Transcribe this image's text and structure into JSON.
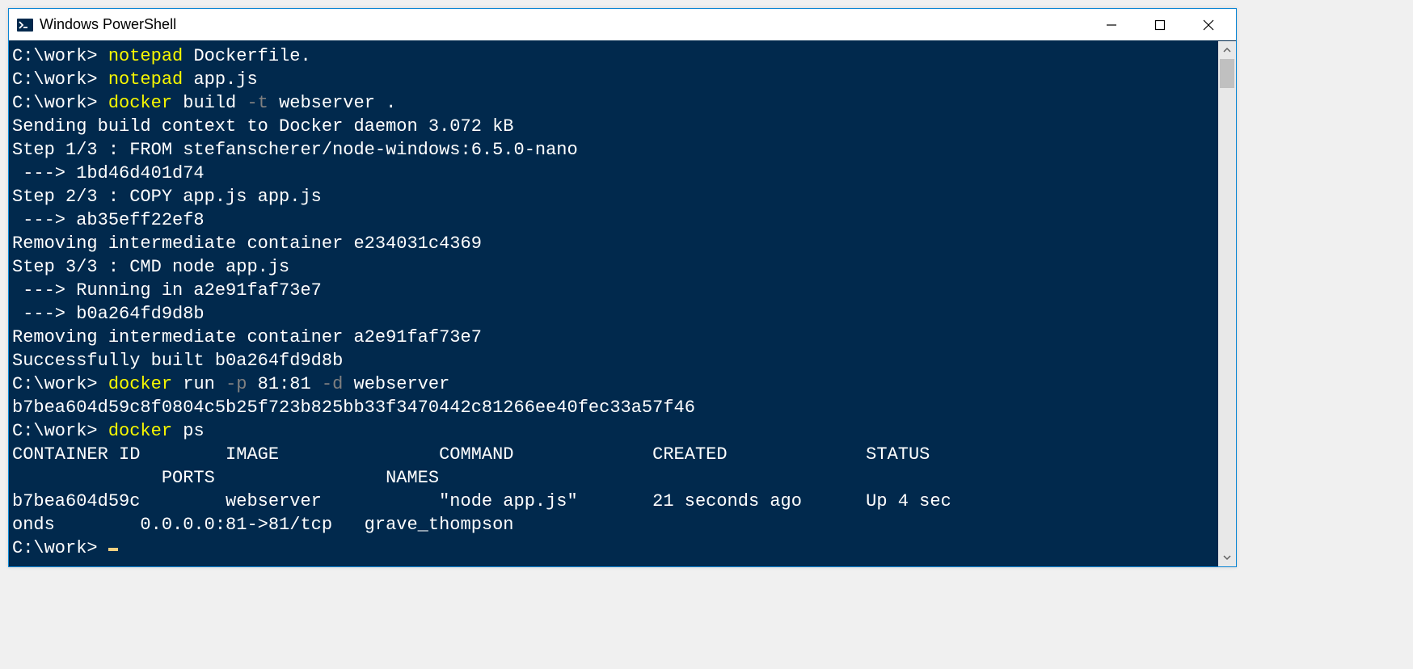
{
  "window": {
    "title": "Windows PowerShell"
  },
  "terminal": {
    "lines": [
      {
        "segments": [
          {
            "text": "C:\\work> ",
            "class": ""
          },
          {
            "text": "notepad ",
            "class": "c-yellow"
          },
          {
            "text": "Dockerfile.",
            "class": ""
          }
        ]
      },
      {
        "segments": [
          {
            "text": "C:\\work> ",
            "class": ""
          },
          {
            "text": "notepad ",
            "class": "c-yellow"
          },
          {
            "text": "app.js",
            "class": ""
          }
        ]
      },
      {
        "segments": [
          {
            "text": "C:\\work> ",
            "class": ""
          },
          {
            "text": "docker ",
            "class": "c-yellow"
          },
          {
            "text": "build ",
            "class": ""
          },
          {
            "text": "-t",
            "class": "c-gray"
          },
          {
            "text": " webserver .",
            "class": ""
          }
        ]
      },
      {
        "segments": [
          {
            "text": "Sending build context to Docker daemon 3.072 kB",
            "class": ""
          }
        ]
      },
      {
        "segments": [
          {
            "text": "Step 1/3 : FROM stefanscherer/node-windows:6.5.0-nano",
            "class": ""
          }
        ]
      },
      {
        "segments": [
          {
            "text": " ---> 1bd46d401d74",
            "class": ""
          }
        ]
      },
      {
        "segments": [
          {
            "text": "Step 2/3 : COPY app.js app.js",
            "class": ""
          }
        ]
      },
      {
        "segments": [
          {
            "text": " ---> ab35eff22ef8",
            "class": ""
          }
        ]
      },
      {
        "segments": [
          {
            "text": "Removing intermediate container e234031c4369",
            "class": ""
          }
        ]
      },
      {
        "segments": [
          {
            "text": "Step 3/3 : CMD node app.js",
            "class": ""
          }
        ]
      },
      {
        "segments": [
          {
            "text": " ---> Running in a2e91faf73e7",
            "class": ""
          }
        ]
      },
      {
        "segments": [
          {
            "text": " ---> b0a264fd9d8b",
            "class": ""
          }
        ]
      },
      {
        "segments": [
          {
            "text": "Removing intermediate container a2e91faf73e7",
            "class": ""
          }
        ]
      },
      {
        "segments": [
          {
            "text": "Successfully built b0a264fd9d8b",
            "class": ""
          }
        ]
      },
      {
        "segments": [
          {
            "text": "C:\\work> ",
            "class": ""
          },
          {
            "text": "docker ",
            "class": "c-yellow"
          },
          {
            "text": "run ",
            "class": ""
          },
          {
            "text": "-p",
            "class": "c-gray"
          },
          {
            "text": " 81:81 ",
            "class": ""
          },
          {
            "text": "-d",
            "class": "c-gray"
          },
          {
            "text": " webserver",
            "class": ""
          }
        ]
      },
      {
        "segments": [
          {
            "text": "b7bea604d59c8f0804c5b25f723b825bb33f3470442c81266ee40fec33a57f46",
            "class": ""
          }
        ]
      },
      {
        "segments": [
          {
            "text": "C:\\work> ",
            "class": ""
          },
          {
            "text": "docker ",
            "class": "c-yellow"
          },
          {
            "text": "ps",
            "class": ""
          }
        ]
      },
      {
        "segments": [
          {
            "text": "CONTAINER ID        IMAGE               COMMAND             CREATED             STATUS",
            "class": ""
          }
        ]
      },
      {
        "segments": [
          {
            "text": "              PORTS                NAMES",
            "class": ""
          }
        ]
      },
      {
        "segments": [
          {
            "text": "b7bea604d59c        webserver           \"node app.js\"       21 seconds ago      Up 4 sec",
            "class": ""
          }
        ]
      },
      {
        "segments": [
          {
            "text": "onds        0.0.0.0:81->81/tcp   grave_thompson",
            "class": ""
          }
        ]
      },
      {
        "segments": [
          {
            "text": "C:\\work> ",
            "class": ""
          },
          {
            "text": "",
            "class": "",
            "cursor": true
          }
        ]
      }
    ]
  }
}
